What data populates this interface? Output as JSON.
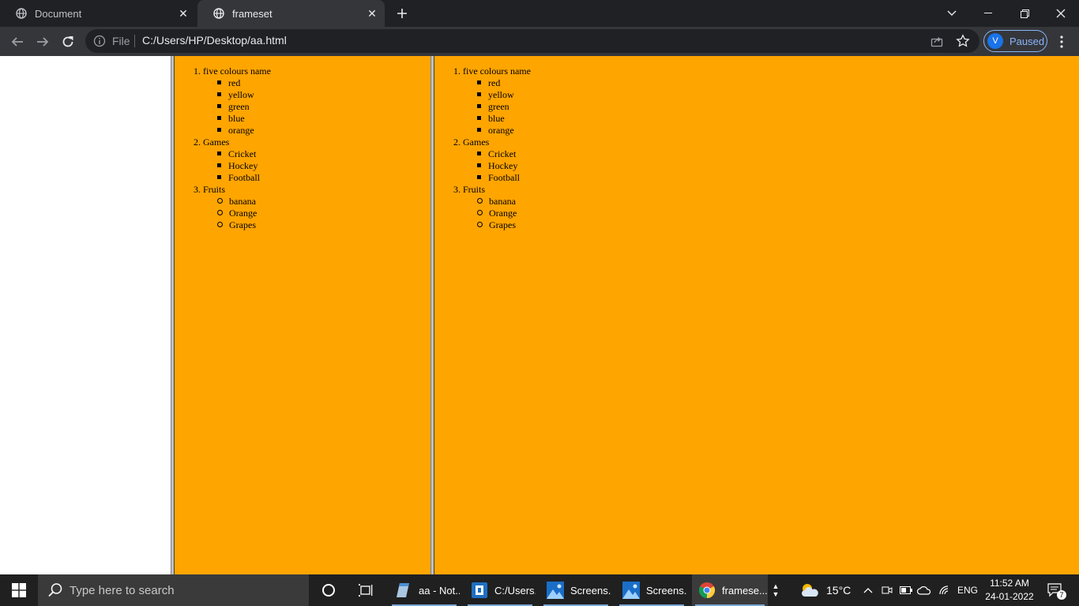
{
  "browser": {
    "tabs": [
      {
        "title": "Document",
        "active": false
      },
      {
        "title": "frameset",
        "active": true
      }
    ],
    "address": {
      "scheme_label": "File",
      "url": "C:/Users/HP/Desktop/aa.html"
    },
    "profile": {
      "initial": "V",
      "status": "Paused"
    },
    "icons": [
      "globe-icon",
      "close-icon",
      "plus-icon",
      "chevron-down-icon",
      "minimize-icon",
      "restore-icon",
      "close-window-icon",
      "back-icon",
      "forward-icon",
      "reload-icon",
      "info-icon",
      "share-icon",
      "star-icon",
      "more-vert-icon"
    ]
  },
  "page": {
    "background": "#ffa500",
    "list": [
      {
        "number": "1.",
        "label": "five colours name",
        "bullet": "square",
        "items": [
          "red",
          "yellow",
          "green",
          "blue",
          "orange"
        ]
      },
      {
        "number": "2.",
        "label": "Games",
        "bullet": "square",
        "items": [
          "Cricket",
          "Hockey",
          "Football"
        ]
      },
      {
        "number": "3.",
        "label": "Fruits",
        "bullet": "circle",
        "items": [
          "banana",
          "Orange",
          "Grapes"
        ]
      }
    ]
  },
  "taskbar": {
    "search_placeholder": "Type here to search",
    "apps": [
      {
        "label": "aa - Not...",
        "icon": "notepad-icon",
        "active": false
      },
      {
        "label": "C:/Users...",
        "icon": "file-explorer-icon",
        "active": false
      },
      {
        "label": "Screens...",
        "icon": "photos-icon",
        "active": false
      },
      {
        "label": "Screens...",
        "icon": "photos-icon",
        "active": false
      },
      {
        "label": "framese...",
        "icon": "chrome-icon",
        "active": true
      }
    ],
    "weather": {
      "temp": "15°C"
    },
    "language": "ENG",
    "time": "11:52 AM",
    "date": "24-01-2022",
    "notifications": "7"
  }
}
